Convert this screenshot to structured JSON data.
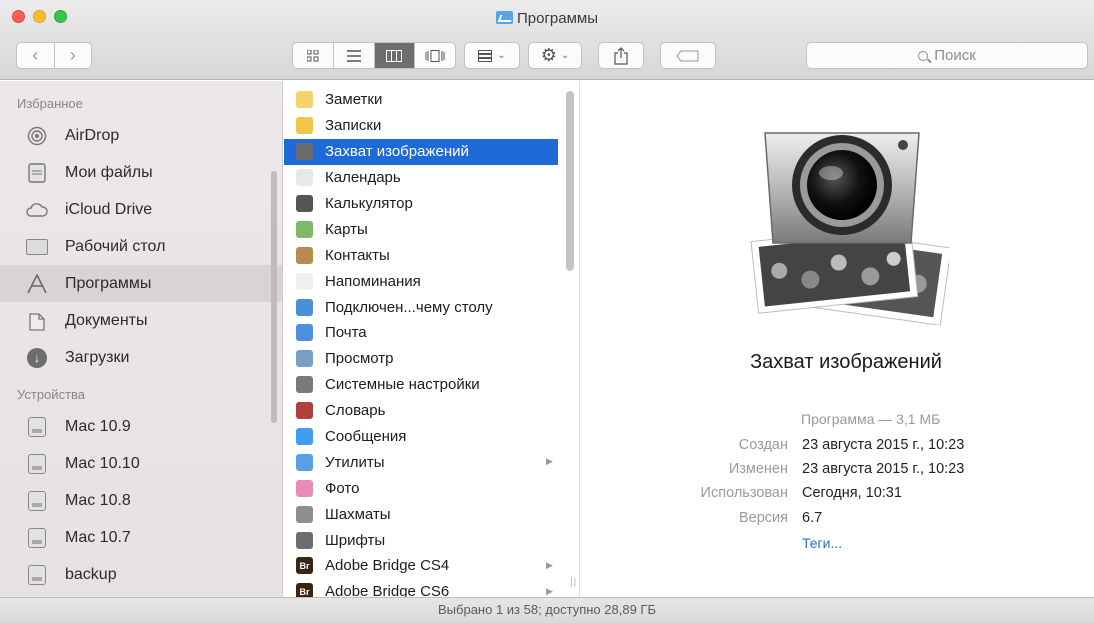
{
  "window": {
    "title": "Программы",
    "accent": "#1f6ad9"
  },
  "toolbar": {
    "back_icon": "chevron-left",
    "forward_icon": "chevron-right",
    "views": [
      "icon-view",
      "list-view",
      "column-view",
      "cover-flow-view"
    ],
    "active_view": "column-view",
    "search_placeholder": "Поиск"
  },
  "sidebar": {
    "favorites_header": "Избранное",
    "favorites": [
      {
        "label": "AirDrop",
        "icon": "airdrop-icon"
      },
      {
        "label": "Мои файлы",
        "icon": "all-files-icon"
      },
      {
        "label": "iCloud Drive",
        "icon": "cloud-icon"
      },
      {
        "label": "Рабочий стол",
        "icon": "desktop-icon"
      },
      {
        "label": "Программы",
        "icon": "applications-icon",
        "selected": true
      },
      {
        "label": "Документы",
        "icon": "documents-icon"
      },
      {
        "label": "Загрузки",
        "icon": "downloads-icon"
      }
    ],
    "devices_header": "Устройства",
    "devices": [
      {
        "label": "Mac 10.9",
        "icon": "disk-icon"
      },
      {
        "label": "Mac 10.10",
        "icon": "disk-icon"
      },
      {
        "label": "Mac 10.8",
        "icon": "disk-icon"
      },
      {
        "label": "Mac 10.7",
        "icon": "disk-icon"
      },
      {
        "label": "backup",
        "icon": "disk-icon"
      }
    ]
  },
  "files": [
    {
      "name": "Заметки",
      "color": "#f2d46b"
    },
    {
      "name": "Записки",
      "color": "#f0c64a"
    },
    {
      "name": "Захват изображений",
      "color": "#6b6b6b",
      "selected": true
    },
    {
      "name": "Календарь",
      "color": "#e8e8e8"
    },
    {
      "name": "Калькулятор",
      "color": "#555555"
    },
    {
      "name": "Карты",
      "color": "#7fb86a"
    },
    {
      "name": "Контакты",
      "color": "#b88a4e"
    },
    {
      "name": "Напоминания",
      "color": "#efefef"
    },
    {
      "name": "Подключен...чему столу",
      "color": "#4a90d9"
    },
    {
      "name": "Почта",
      "color": "#4f8fe0"
    },
    {
      "name": "Просмотр",
      "color": "#7a9fc7"
    },
    {
      "name": "Системные настройки",
      "color": "#7a7a7a"
    },
    {
      "name": "Словарь",
      "color": "#b0413e"
    },
    {
      "name": "Сообщения",
      "color": "#3f9cf2"
    },
    {
      "name": "Утилиты",
      "color": "#5a9ee6",
      "folder": true
    },
    {
      "name": "Фото",
      "color": "#e98bb8"
    },
    {
      "name": "Шахматы",
      "color": "#8f8f8f"
    },
    {
      "name": "Шрифты",
      "color": "#6e6e6e"
    },
    {
      "name": "Adobe Bridge CS4",
      "color": "#3b2410",
      "badge": "Br",
      "folder": true
    },
    {
      "name": "Adobe Bridge CS6",
      "color": "#3b2410",
      "badge": "Br",
      "folder": true
    }
  ],
  "preview": {
    "app_name": "Захват изображений",
    "kind": "Программа — 3,1 МБ",
    "created_label": "Создан",
    "created_value": "23 августа 2015 г., 10:23",
    "modified_label": "Изменен",
    "modified_value": "23 августа 2015 г., 10:23",
    "opened_label": "Использован",
    "opened_value": "Сегодня, 10:31",
    "version_label": "Версия",
    "version_value": "6.7",
    "tags_link": "Теги..."
  },
  "status": {
    "text": "Выбрано 1 из 58; доступно 28,89 ГБ"
  }
}
